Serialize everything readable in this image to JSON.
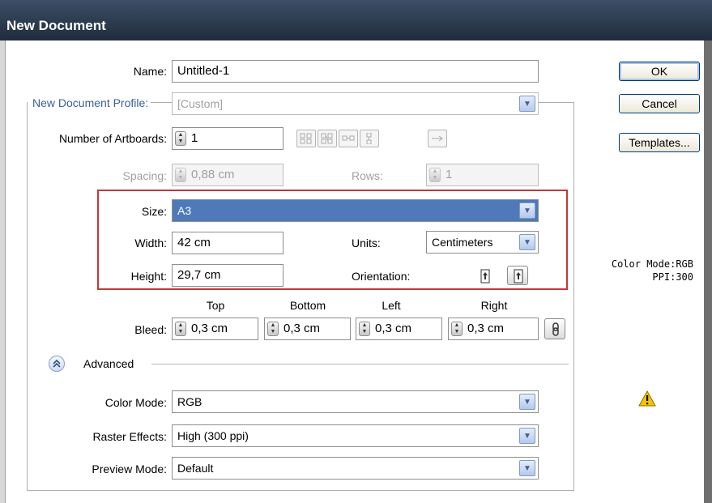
{
  "window": {
    "title": "New Document"
  },
  "buttons": {
    "ok": "OK",
    "cancel": "Cancel",
    "templates": "Templates..."
  },
  "name": {
    "label": "Name:",
    "value": "Untitled-1"
  },
  "profile": {
    "label": "New Document Profile:",
    "value": "[Custom]"
  },
  "artboards": {
    "label": "Number of Artboards:",
    "value": "1"
  },
  "spacing": {
    "label": "Spacing:",
    "value": "0,88 cm"
  },
  "rows": {
    "label": "Rows:",
    "value": "1"
  },
  "size": {
    "label": "Size:",
    "value": "A3"
  },
  "width": {
    "label": "Width:",
    "value": "42 cm"
  },
  "height": {
    "label": "Height:",
    "value": "29,7 cm"
  },
  "units": {
    "label": "Units:",
    "value": "Centimeters"
  },
  "orientation": {
    "label": "Orientation:",
    "selected": "landscape"
  },
  "bleed": {
    "label": "Bleed:",
    "headers": {
      "top": "Top",
      "bottom": "Bottom",
      "left": "Left",
      "right": "Right"
    },
    "values": {
      "top": "0,3 cm",
      "bottom": "0,3 cm",
      "left": "0,3 cm",
      "right": "0,3 cm"
    }
  },
  "advanced": {
    "label": "Advanced",
    "expanded": true
  },
  "color_mode": {
    "label": "Color Mode:",
    "value": "RGB"
  },
  "raster_effects": {
    "label": "Raster Effects:",
    "value": "High (300 ppi)"
  },
  "preview_mode": {
    "label": "Preview Mode:",
    "value": "Default"
  },
  "info": {
    "color_mode": "Color Mode:RGB",
    "ppi": "PPI:300"
  },
  "icons": {
    "spinner": "up-down-spinner-icon",
    "dropdown": "chevron-down-icon",
    "warning": "warning-icon",
    "link": "chain-link-icon",
    "advanced_toggle": "double-chevron-up-icon"
  },
  "colors": {
    "titlebar": "#1f2c3c",
    "selection": "#4f79b8",
    "highlight_box": "#c1393d",
    "warning": "#f2c500"
  }
}
